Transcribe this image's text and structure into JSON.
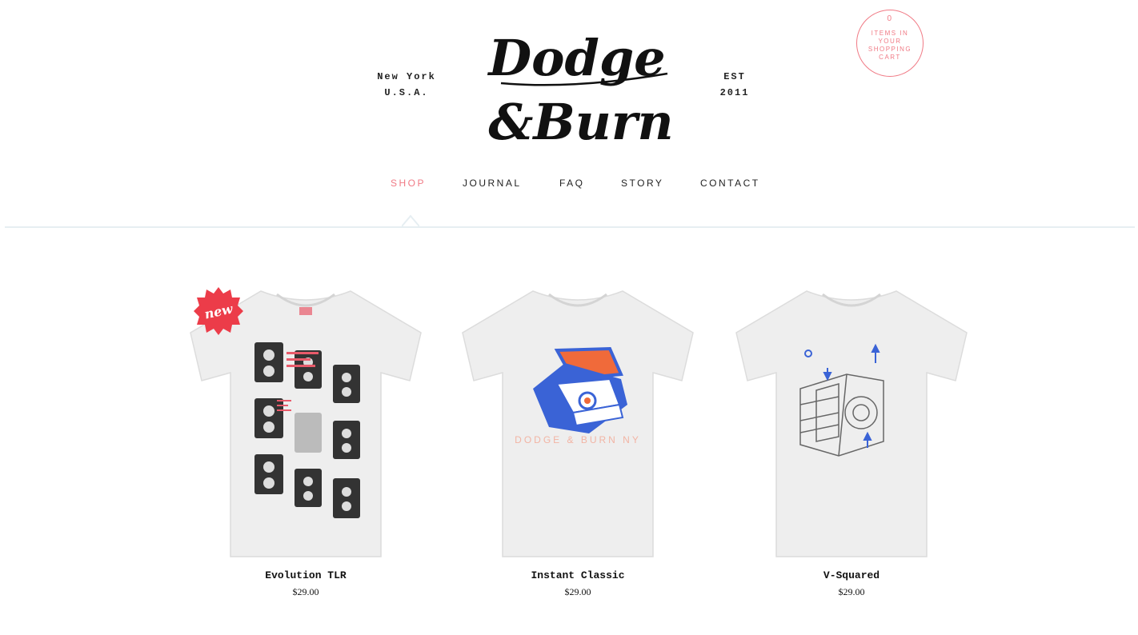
{
  "header": {
    "location_line1": "New York",
    "location_line2": "U.S.A.",
    "est_line1": "EST",
    "est_line2": "2011",
    "logo_text": "Dodge & Burn"
  },
  "cart": {
    "count": "0",
    "label": "ITEMS IN YOUR SHOPPING CART"
  },
  "nav": {
    "items": [
      {
        "label": "SHOP",
        "active": true
      },
      {
        "label": "JOURNAL",
        "active": false
      },
      {
        "label": "FAQ",
        "active": false
      },
      {
        "label": "STORY",
        "active": false
      },
      {
        "label": "CONTACT",
        "active": false
      }
    ]
  },
  "products": [
    {
      "name": "Evolution TLR",
      "price": "$29.00",
      "badge": "new"
    },
    {
      "name": "Instant Classic",
      "price": "$29.00",
      "shirt_print": "DODGE & BURN NY"
    },
    {
      "name": "V-Squared",
      "price": "$29.00"
    }
  ],
  "colors": {
    "accent": "#f07a85",
    "divider": "#e6eef2",
    "polaroid_blue": "#3a63d6",
    "polaroid_orange": "#f06a3a"
  }
}
